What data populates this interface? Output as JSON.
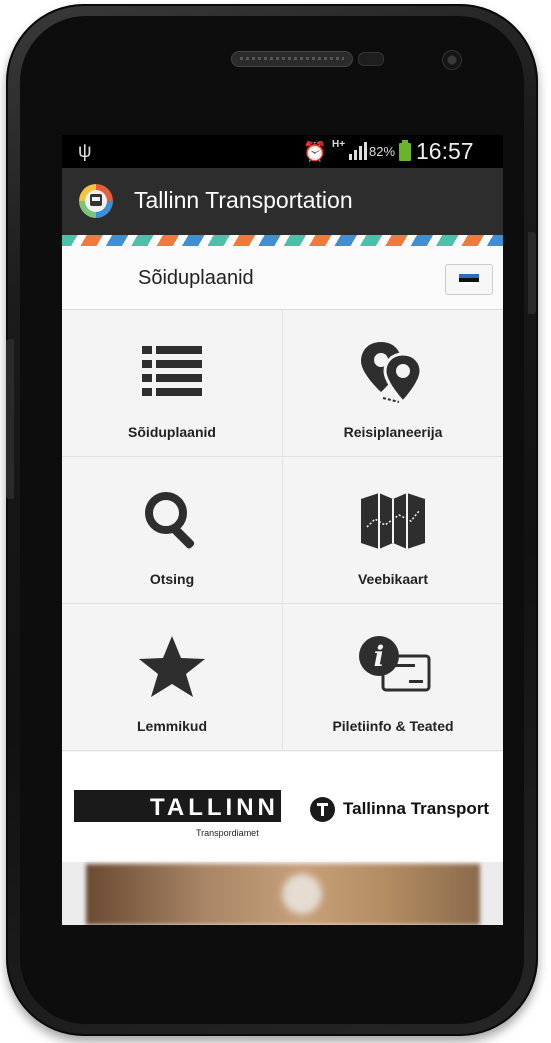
{
  "statusbar": {
    "battery_percent": "82%",
    "time": "16:57",
    "network": "H+"
  },
  "actionbar": {
    "title": "Tallinn Transportation"
  },
  "subheader": {
    "title": "Sõiduplaanid",
    "language_flag": "Estonian flag"
  },
  "menu": {
    "items": [
      {
        "label": "Sõiduplaanid",
        "icon": "list-icon"
      },
      {
        "label": "Reisiplaneerija",
        "icon": "route-pins-icon"
      },
      {
        "label": "Otsing",
        "icon": "search-icon"
      },
      {
        "label": "Veebikaart",
        "icon": "map-icon"
      },
      {
        "label": "Lemmikud",
        "icon": "star-icon"
      },
      {
        "label": "Piletiinfo & Teated",
        "icon": "info-ticket-icon"
      }
    ]
  },
  "logos": {
    "tallinn_word": "TALLINN",
    "tallinn_sub": "Transpordiamet",
    "transport_name": "Tallinna Transport"
  },
  "colors": {
    "actionbar_bg": "#2d2d2d",
    "stripe_blue": "#3f8fd2",
    "stripe_orange": "#ef7a3b",
    "stripe_teal": "#4cc0a9",
    "battery_green": "#6ab42c"
  }
}
